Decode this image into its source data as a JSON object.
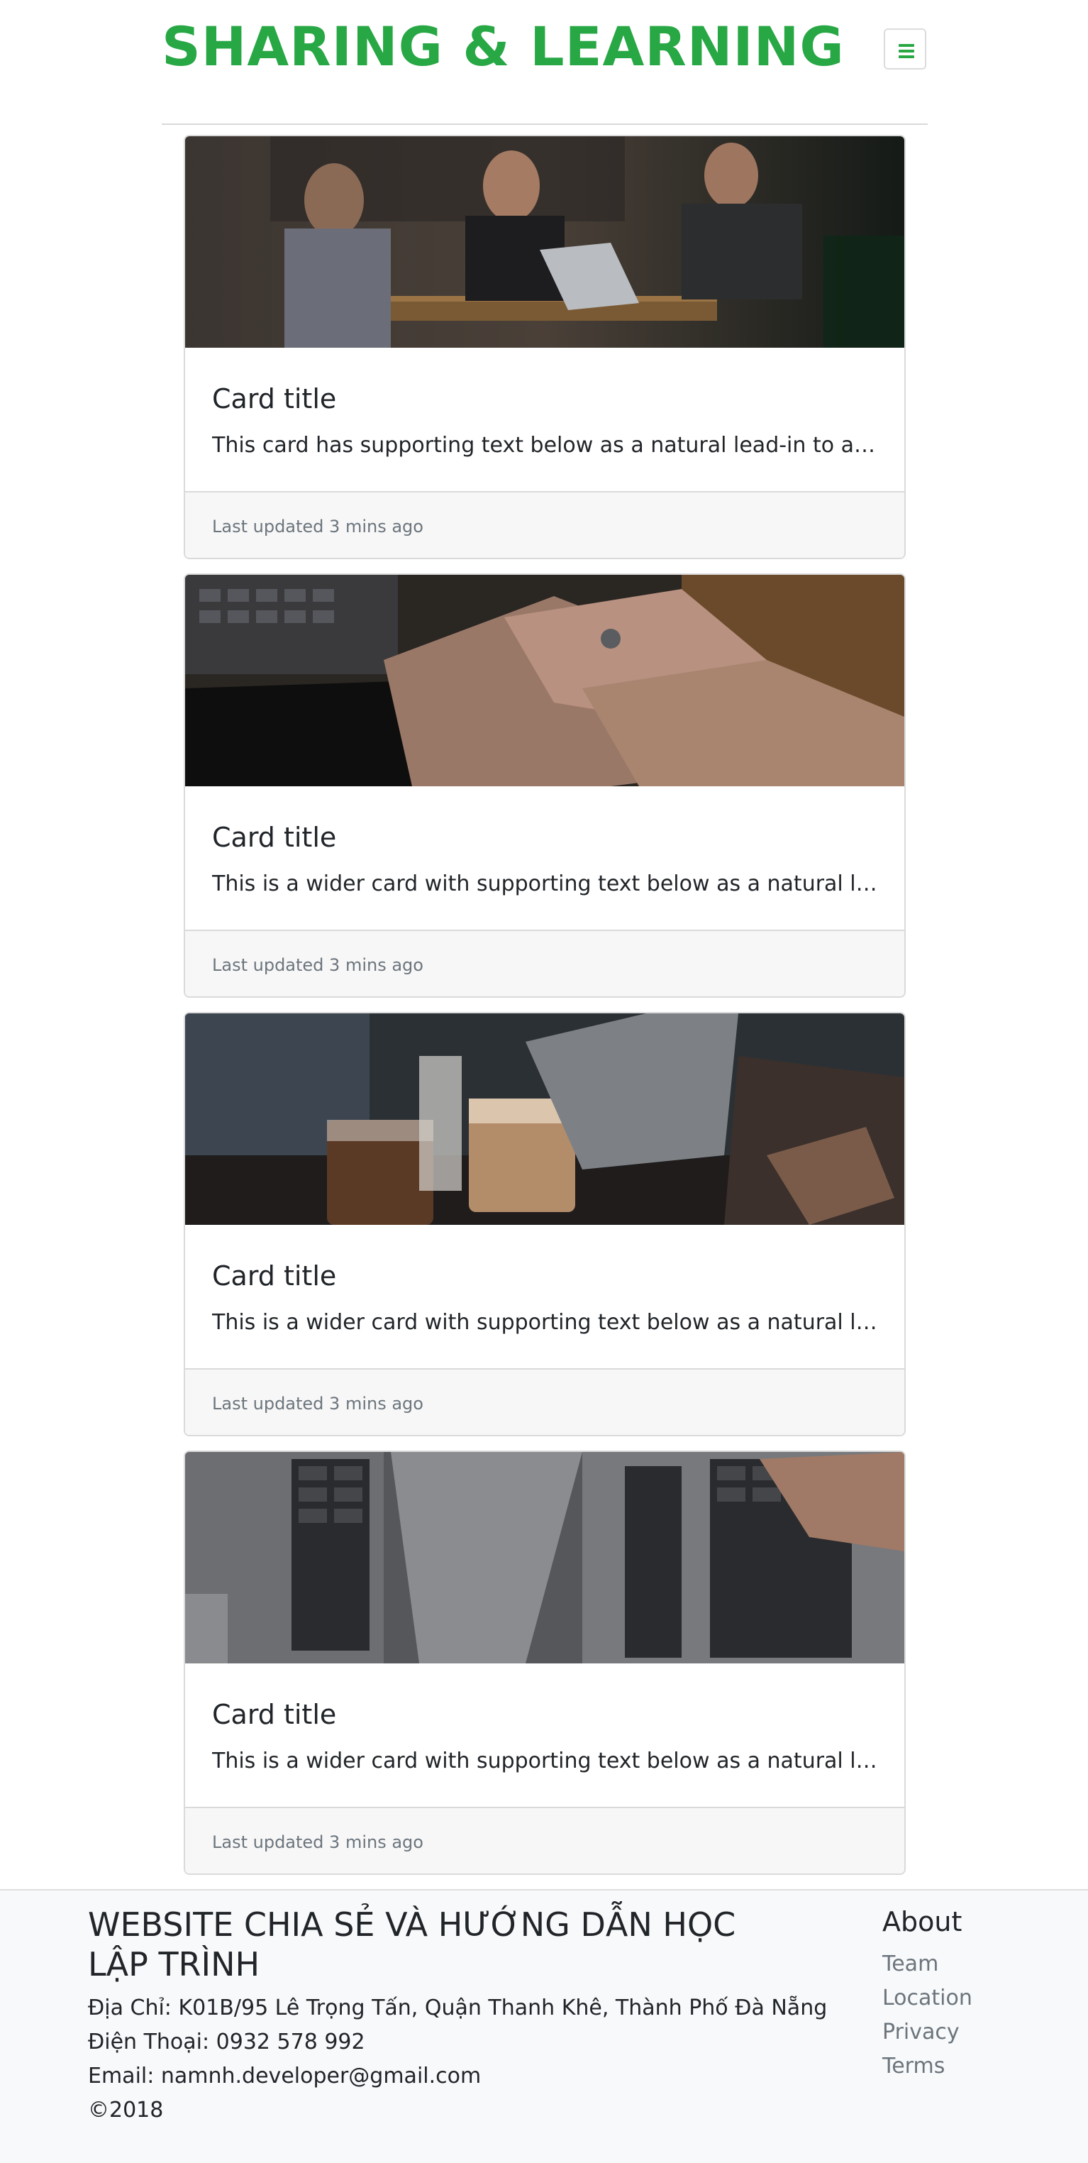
{
  "navbar": {
    "brand": "SHARING & LEARNING",
    "toggler_icon": "hamburger-menu-icon",
    "accent_color": "#28a745"
  },
  "cards": [
    {
      "image": "people-working-at-cafe-table-photo",
      "title": "Card title",
      "text": "This card has supporting text below as a natural lead-in to additional content.",
      "footer": "Last updated 3 mins ago"
    },
    {
      "image": "stacked-hands-photo",
      "title": "Card title",
      "text": "This is a wider card with supporting text below as a natural lead-in to additional content.",
      "footer": "Last updated 3 mins ago"
    },
    {
      "image": "coffee-cups-and-laptop-photo",
      "title": "Card title",
      "text": "This is a wider card with supporting text below as a natural lead-in to additional content.",
      "footer": "Last updated 3 mins ago"
    },
    {
      "image": "laptops-keyboards-photo",
      "title": "Card title",
      "text": "This is a wider card with supporting text below as a natural lead-in to additional content.",
      "footer": "Last updated 3 mins ago"
    }
  ],
  "footer": {
    "site_name": "WEBSITE CHIA SẺ VÀ HƯỚNG DẪN HỌC LẬP TRÌNH",
    "address": "Địa Chỉ: K01B/95 Lê Trọng Tấn, Quận Thanh Khê, Thành Phố Đà Nẵng",
    "phone": "Điện Thoại: 0932 578 992",
    "email": "Email: namnh.developer@gmail.com",
    "copyright": "©2018",
    "about": {
      "heading": "About",
      "links": [
        "Team",
        "Location",
        "Privacy",
        "Terms"
      ]
    }
  }
}
